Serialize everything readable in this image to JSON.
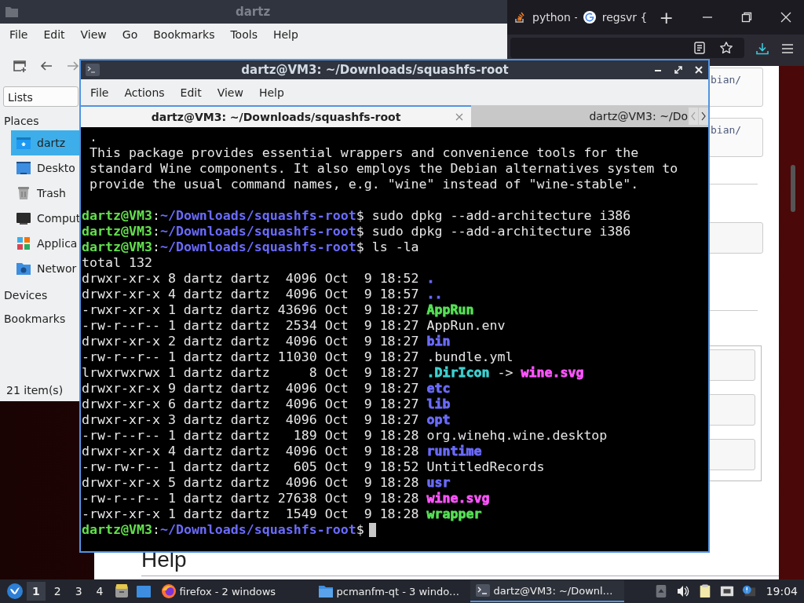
{
  "browser": {
    "tabs": [
      {
        "label": "python -",
        "kind": "stack",
        "selected": false
      },
      {
        "label": "regsvr {",
        "kind": "google",
        "selected": false
      }
    ],
    "new_tab": "+",
    "snippets": [
      "bian/",
      "bian/"
    ],
    "heading": "Help"
  },
  "file_manager": {
    "title": "dartz",
    "menu": [
      "File",
      "Edit",
      "View",
      "Go",
      "Bookmarks",
      "Tools",
      "Help"
    ],
    "view_select": "Lists",
    "sections": [
      {
        "label": "Places",
        "items": [
          {
            "label": "dartz",
            "kind": "home",
            "selected": true
          },
          {
            "label": "Deskto",
            "kind": "desktop",
            "selected": false
          },
          {
            "label": "Trash",
            "kind": "trash",
            "selected": false
          },
          {
            "label": "Comput",
            "kind": "computer",
            "selected": false
          },
          {
            "label": "Applica",
            "kind": "apps",
            "selected": false
          },
          {
            "label": "Networ",
            "kind": "network",
            "selected": false
          }
        ]
      },
      {
        "label": "Devices"
      },
      {
        "label": "Bookmarks"
      }
    ],
    "status": "21 item(s)"
  },
  "terminal": {
    "title": "dartz@VM3: ~/Downloads/squashfs-root",
    "menu": [
      "File",
      "Actions",
      "Edit",
      "View",
      "Help"
    ],
    "tabs": [
      {
        "label": "dartz@VM3: ~/Downloads/squashfs-root",
        "selected": true
      },
      {
        "label": "dartz@VM3: ~/Do",
        "selected": false
      }
    ],
    "lines": [
      {
        "kind": "text",
        "text": "."
      },
      {
        "kind": "text",
        "text": "This package provides essential wrappers and convenience tools for the"
      },
      {
        "kind": "text",
        "text": "standard Wine components. It also employs the Debian alternatives system to"
      },
      {
        "kind": "text",
        "text": "provide the usual command names, e.g. \"wine\" instead of \"wine-stable\"."
      },
      {
        "kind": "blank"
      },
      {
        "kind": "prompt",
        "user": "dartz@VM3",
        "colon": ":",
        "path": "~/Downloads/squashfs-root",
        "tail": "$ sudo dpkg --add-architecture i386",
        "cursor": false
      },
      {
        "kind": "prompt",
        "user": "dartz@VM3",
        "colon": ":",
        "path": "~/Downloads/squashfs-root",
        "tail": "$ sudo dpkg --add-architecture i386",
        "cursor": false
      },
      {
        "kind": "prompt",
        "user": "dartz@VM3",
        "colon": ":",
        "path": "~/Downloads/squashfs-root",
        "tail": "$ ls -la",
        "cursor": false
      },
      {
        "kind": "plain",
        "text": "total 132"
      },
      {
        "kind": "entry",
        "info": "drwxr-xr-x 8 dartz dartz  4096 Oct  9 18:52",
        "name": ".",
        "color": "#6b6bff"
      },
      {
        "kind": "entry",
        "info": "drwxr-xr-x 4 dartz dartz  4096 Oct  9 18:57",
        "name": "..",
        "color": "#6b6bff"
      },
      {
        "kind": "entry",
        "info": "-rwxr-xr-x 1 dartz dartz 43696 Oct  9 18:27",
        "name": "AppRun",
        "color": "#55e055"
      },
      {
        "kind": "entry",
        "info": "-rw-r--r-- 1 dartz dartz  2534 Oct  9 18:27",
        "name": "AppRun.env",
        "color": "#e6e6e6"
      },
      {
        "kind": "entry",
        "info": "drwxr-xr-x 2 dartz dartz  4096 Oct  9 18:27",
        "name": "bin",
        "color": "#6b6bff"
      },
      {
        "kind": "entry",
        "info": "-rw-r--r-- 1 dartz dartz 11030 Oct  9 18:27",
        "name": ".bundle.yml",
        "color": "#e6e6e6"
      },
      {
        "kind": "entry",
        "info": "lrwxrwxrwx 1 dartz dartz     8 Oct  9 18:27",
        "name": ".DirIcon",
        "color": "#3fd0d0",
        "arrow": "->",
        "target": {
          "text": "wine.svg",
          "color": "#ff55ff"
        }
      },
      {
        "kind": "entry",
        "info": "drwxr-xr-x 9 dartz dartz  4096 Oct  9 18:27",
        "name": "etc",
        "color": "#6b6bff"
      },
      {
        "kind": "entry",
        "info": "drwxr-xr-x 6 dartz dartz  4096 Oct  9 18:27",
        "name": "lib",
        "color": "#6b6bff"
      },
      {
        "kind": "entry",
        "info": "drwxr-xr-x 3 dartz dartz  4096 Oct  9 18:27",
        "name": "opt",
        "color": "#6b6bff"
      },
      {
        "kind": "entry",
        "info": "-rw-r--r-- 1 dartz dartz   189 Oct  9 18:28",
        "name": "org.winehq.wine.desktop",
        "color": "#e6e6e6"
      },
      {
        "kind": "entry",
        "info": "drwxr-xr-x 4 dartz dartz  4096 Oct  9 18:28",
        "name": "runtime",
        "color": "#6b6bff"
      },
      {
        "kind": "entry",
        "info": "-rw-rw-r-- 1 dartz dartz   605 Oct  9 18:52",
        "name": "UntitledRecords",
        "color": "#e6e6e6"
      },
      {
        "kind": "entry",
        "info": "drwxr-xr-x 5 dartz dartz  4096 Oct  9 18:28",
        "name": "usr",
        "color": "#6b6bff"
      },
      {
        "kind": "entry",
        "info": "-rw-r--r-- 1 dartz dartz 27638 Oct  9 18:28",
        "name": "wine.svg",
        "color": "#ff55ff"
      },
      {
        "kind": "entry",
        "info": "-rwxr-xr-x 1 dartz dartz  1549 Oct  9 18:28",
        "name": "wrapper",
        "color": "#55e055"
      },
      {
        "kind": "prompt",
        "user": "dartz@VM3",
        "colon": ":",
        "path": "~/Downloads/squashfs-root",
        "tail": "$",
        "cursor": true
      }
    ]
  },
  "taskbar": {
    "workspaces": [
      {
        "label": "1",
        "selected": true
      },
      {
        "label": "2",
        "selected": false
      },
      {
        "label": "3",
        "selected": false
      },
      {
        "label": "4",
        "selected": false
      }
    ],
    "tasks": [
      {
        "label": "firefox - 2 windows",
        "kind": "firefox",
        "selected": false
      },
      {
        "label": "pcmanfm-qt - 3 windo…",
        "kind": "folder",
        "selected": false
      },
      {
        "label": "dartz@VM3: ~/Downl…",
        "kind": "terminal",
        "selected": true
      }
    ],
    "clock": "19:04"
  }
}
